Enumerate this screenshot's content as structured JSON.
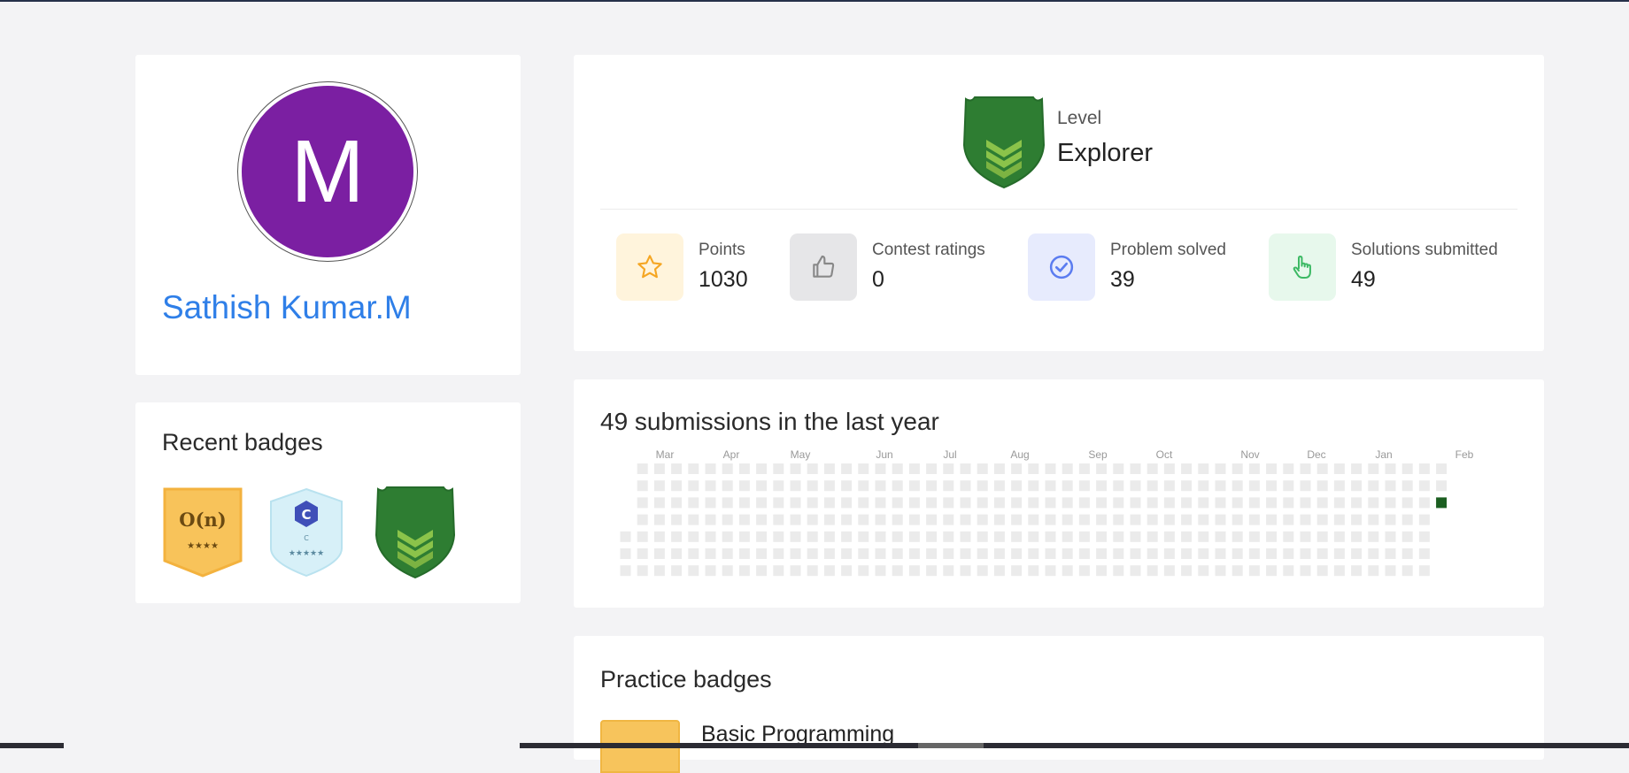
{
  "profile": {
    "avatar_letter": "M",
    "avatar_color": "#7b1fa2",
    "name": "Sathish Kumar.M",
    "name_color": "#2f7fe8"
  },
  "recent_badges": {
    "title": "Recent badges",
    "items": [
      {
        "icon": "complexity-badge-icon",
        "text": "O(n)",
        "stars": "★★★★"
      },
      {
        "icon": "c-language-badge-icon",
        "letter": "C",
        "caption": "C",
        "stars": "★★★★★"
      },
      {
        "icon": "explorer-shield-badge-icon"
      }
    ]
  },
  "level": {
    "label": "Level",
    "value": "Explorer",
    "shield_color": "#2e7d32"
  },
  "stats": [
    {
      "label": "Points",
      "value": "1030",
      "icon": "star-icon",
      "tile_color": "#fff4dc",
      "icon_color": "#f5a623"
    },
    {
      "label": "Contest ratings",
      "value": "0",
      "icon": "thumbs-up-icon",
      "tile_color": "#e6e6e8",
      "icon_color": "#888888"
    },
    {
      "label": "Problem solved",
      "value": "39",
      "icon": "check-circle-icon",
      "tile_color": "#e7ebfd",
      "icon_color": "#5b7cf0"
    },
    {
      "label": "Solutions submitted",
      "value": "49",
      "icon": "pointing-hand-icon",
      "tile_color": "#e7f8ec",
      "icon_color": "#3cb964"
    }
  ],
  "activity": {
    "title": "49 submissions in the last year",
    "months": [
      "Mar",
      "Apr",
      "May",
      "Jun",
      "Jul",
      "Aug",
      "Sep",
      "Oct",
      "Nov",
      "Dec",
      "Jan",
      "Feb"
    ],
    "empty_color": "#ebebeb",
    "active_color": "#1b5e20"
  },
  "practice_badges": {
    "title": "Practice badges",
    "first_item": "Basic Programming"
  }
}
